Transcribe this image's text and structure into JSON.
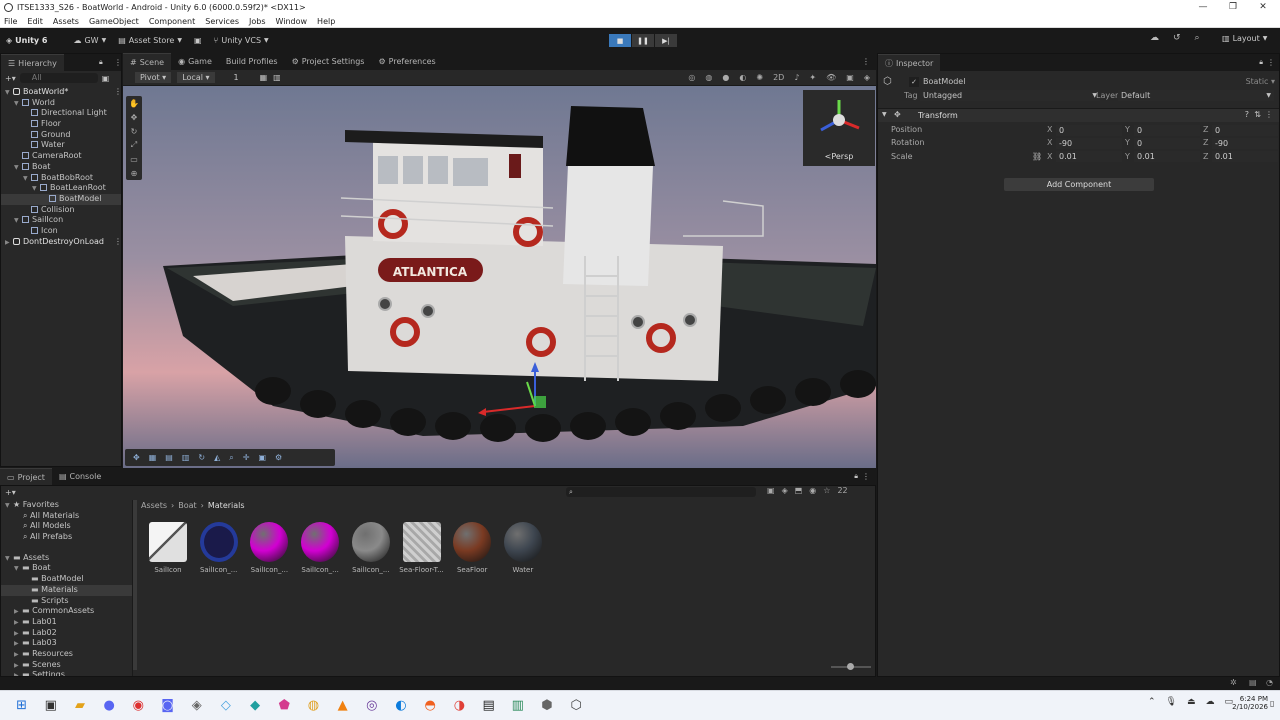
{
  "window": {
    "title": "ITSE1333_S26 - BoatWorld - Android - Unity 6.0 (6000.0.59f2)* <DX11>",
    "controls": [
      "—",
      "❐",
      "✕"
    ]
  },
  "menu": [
    "File",
    "Edit",
    "Assets",
    "GameObject",
    "Component",
    "Services",
    "Jobs",
    "Window",
    "Help"
  ],
  "toolbar": {
    "brand": "Unity 6",
    "account": "GW",
    "asset_store": "Asset Store",
    "vcs": "Unity VCS",
    "layout": "Layout"
  },
  "hierarchy": {
    "tab": "Hierarchy",
    "search_placeholder": "All",
    "rows": [
      {
        "label": "BoatWorld*",
        "indent": 0,
        "kind": "scene"
      },
      {
        "label": "World",
        "indent": 1,
        "kind": "go"
      },
      {
        "label": "Directional Light",
        "indent": 2,
        "kind": "go"
      },
      {
        "label": "Floor",
        "indent": 2,
        "kind": "go"
      },
      {
        "label": "Ground",
        "indent": 2,
        "kind": "go"
      },
      {
        "label": "Water",
        "indent": 2,
        "kind": "go"
      },
      {
        "label": "CameraRoot",
        "indent": 1,
        "kind": "go"
      },
      {
        "label": "Boat",
        "indent": 1,
        "kind": "go"
      },
      {
        "label": "BoatBobRoot",
        "indent": 2,
        "kind": "go"
      },
      {
        "label": "BoatLeanRoot",
        "indent": 3,
        "kind": "go"
      },
      {
        "label": "BoatModel",
        "indent": 4,
        "kind": "go",
        "selected": true
      },
      {
        "label": "Collision",
        "indent": 2,
        "kind": "go"
      },
      {
        "label": "SailIcon",
        "indent": 1,
        "kind": "go"
      },
      {
        "label": "Icon",
        "indent": 2,
        "kind": "go"
      },
      {
        "label": "DontDestroyOnLoad",
        "indent": 0,
        "kind": "scene"
      }
    ]
  },
  "tabs_center": [
    {
      "label": "Scene",
      "active": true
    },
    {
      "label": "Game",
      "active": false
    },
    {
      "label": "Build Profiles",
      "active": false
    },
    {
      "label": "Project Settings",
      "active": false
    },
    {
      "label": "Preferences",
      "active": false
    }
  ],
  "scene_toolbar": {
    "pivot": "Pivot",
    "space": "Local",
    "grid_value": "1"
  },
  "scene": {
    "gizmo_label": "<Persp",
    "boat_name": "ATLANTICA"
  },
  "inspector": {
    "tab": "Inspector",
    "object_name": "BoatModel",
    "static_label": "Static",
    "tag_label": "Tag",
    "tag_value": "Untagged",
    "layer_label": "Layer",
    "layer_value": "Default",
    "component": "Transform",
    "rows": [
      {
        "label": "Position",
        "x": "0",
        "y": "0",
        "z": "0"
      },
      {
        "label": "Rotation",
        "x": "-90",
        "y": "0",
        "z": "-90"
      },
      {
        "label": "Scale",
        "x": "0.01",
        "y": "0.01",
        "z": "0.01"
      }
    ],
    "axis": [
      "X",
      "Y",
      "Z"
    ],
    "add_component": "Add Component"
  },
  "bottom_tabs": [
    {
      "label": "Project",
      "active": true
    },
    {
      "label": "Console",
      "active": false
    }
  ],
  "project": {
    "favorites": {
      "title": "Favorites",
      "items": [
        "All Materials",
        "All Models",
        "All Prefabs"
      ]
    },
    "assets_tree": [
      {
        "label": "Assets",
        "indent": 0
      },
      {
        "label": "Boat",
        "indent": 1
      },
      {
        "label": "BoatModel",
        "indent": 2
      },
      {
        "label": "Materials",
        "indent": 2,
        "selected": true
      },
      {
        "label": "Scripts",
        "indent": 2
      },
      {
        "label": "CommonAssets",
        "indent": 1
      },
      {
        "label": "Lab01",
        "indent": 1
      },
      {
        "label": "Lab02",
        "indent": 1
      },
      {
        "label": "Lab03",
        "indent": 1
      },
      {
        "label": "Resources",
        "indent": 1
      },
      {
        "label": "Scenes",
        "indent": 1
      },
      {
        "label": "Settings",
        "indent": 1
      }
    ],
    "breadcrumb": [
      "Assets",
      "Boat",
      "Materials"
    ],
    "item_count": "22",
    "assets": [
      {
        "label": "SailIcon",
        "color": "#e8e8e8",
        "kind": "sail"
      },
      {
        "label": "SailIcon_...",
        "color": "#1a1a4a",
        "kind": "ring"
      },
      {
        "label": "SailIcon_...",
        "color": "#d200d2",
        "kind": "sphere"
      },
      {
        "label": "SailIcon_...",
        "color": "#d200d2",
        "kind": "sphere"
      },
      {
        "label": "SailIcon_...",
        "color": "#8a8a8a",
        "kind": "sphere"
      },
      {
        "label": "Sea-Floor-T...",
        "color": "#b8b8b8",
        "kind": "texture"
      },
      {
        "label": "SeaFloor",
        "color": "#7a3a22",
        "kind": "sphere"
      },
      {
        "label": "Water",
        "color": "#3e4650",
        "kind": "sphere"
      }
    ]
  },
  "taskbar": {
    "time": "6:24 PM",
    "date": "2/10/2026",
    "apps": [
      "windows-start",
      "task-view",
      "file-explorer",
      "discord-alt",
      "chrome-dev",
      "discord",
      "misc-a",
      "misc-b",
      "misc-c",
      "misc-d",
      "misc-e",
      "vlc",
      "obs",
      "edge",
      "firefox",
      "chrome",
      "terminal",
      "notepad",
      "unity-hub",
      "unity"
    ]
  }
}
